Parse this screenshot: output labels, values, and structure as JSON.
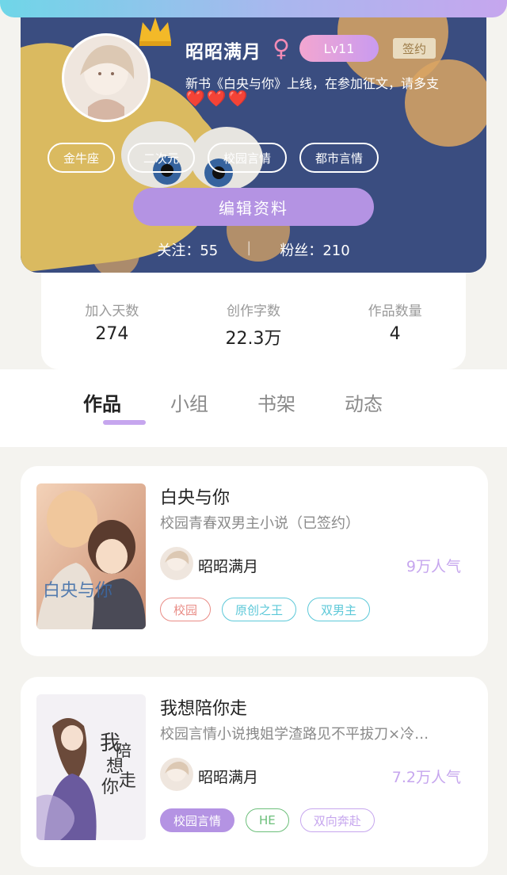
{
  "profile": {
    "username": "昭昭满月",
    "gender_symbol": "♀",
    "level": "Lv11",
    "sign_badge": "签约",
    "bio": "新书《白央与你》上线，在参加征文，请多支",
    "hearts": "❤️❤️❤️",
    "tags": [
      "金牛座",
      "二次元",
      "校园言情",
      "都市言情"
    ],
    "edit_button": "编辑资料",
    "follow_label": "关注：",
    "follow_count": "55",
    "divider": "|",
    "fans_label": "粉丝：",
    "fans_count": "210"
  },
  "stats": [
    {
      "label": "加入天数",
      "value": "274"
    },
    {
      "label": "创作字数",
      "value": "22.3万"
    },
    {
      "label": "作品数量",
      "value": "4"
    }
  ],
  "tabs": [
    {
      "label": "作品",
      "active": true
    },
    {
      "label": "小组",
      "active": false
    },
    {
      "label": "书架",
      "active": false
    },
    {
      "label": "动态",
      "active": false
    }
  ],
  "works": [
    {
      "title": "白央与你",
      "description": "校园青春双男主小说（已签约）",
      "author": "昭昭满月",
      "popularity": "9万人气",
      "tags": [
        {
          "label": "校园",
          "color": "#e98c86"
        },
        {
          "label": "原创之王",
          "color": "#5cc8d8"
        },
        {
          "label": "双男主",
          "color": "#5cc8d8"
        }
      ]
    },
    {
      "title": "我想陪你走",
      "description": "校园言情小说拽姐学渣路见不平拔刀×冷…",
      "author": "昭昭满月",
      "popularity": "7.2万人气",
      "tags": [
        {
          "label": "校园言情",
          "color": "#b493e3",
          "filled": true
        },
        {
          "label": "HE",
          "color": "#6cbf7a"
        },
        {
          "label": "双向奔赴",
          "color": "#c6a6ee"
        }
      ]
    }
  ],
  "colors": {
    "accent": "#b493e3",
    "accent_light": "#c6a6ee",
    "card_bg": "#3b4f86"
  }
}
